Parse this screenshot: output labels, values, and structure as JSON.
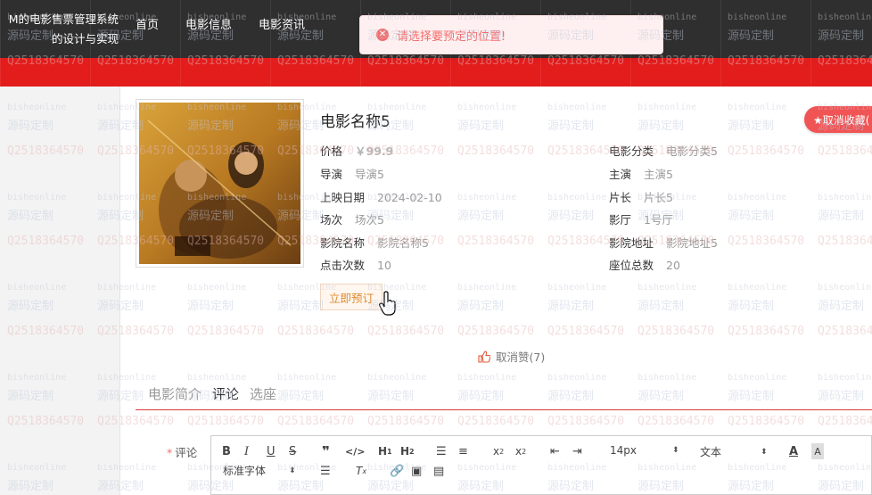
{
  "header": {
    "brand_line1": "M的电影售票管理系统",
    "brand_line2": "的设计与实现",
    "nav": [
      "首页",
      "电影信息",
      "电影资讯"
    ]
  },
  "toast": {
    "icon": "error-circle-icon",
    "message": "请选择要预定的位置!"
  },
  "movie": {
    "title": "电影名称5",
    "left_fields": [
      {
        "label": "价格",
        "value": "￥99.9"
      },
      {
        "label": "导演",
        "value": "导演5"
      },
      {
        "label": "上映日期",
        "value": "2024-02-10"
      },
      {
        "label": "场次",
        "value": "场次5"
      },
      {
        "label": "影院名称",
        "value": "影院名称5"
      },
      {
        "label": "点击次数",
        "value": "10"
      }
    ],
    "right_fields": [
      {
        "label": "电影分类",
        "value": "电影分类5"
      },
      {
        "label": "主演",
        "value": "主演5"
      },
      {
        "label": "片长",
        "value": "片长5"
      },
      {
        "label": "影厅",
        "value": "1号厅"
      },
      {
        "label": "影院地址",
        "value": "影院地址5"
      },
      {
        "label": "座位总数",
        "value": "20"
      }
    ],
    "favorite_label": "★取消收藏(",
    "book_label": "立即预订",
    "like_label": "取消赞(7)"
  },
  "tabs": [
    "电影简介",
    "评论",
    "选座"
  ],
  "active_tab": "评论",
  "comment": {
    "required_mark": "*",
    "label": "评论",
    "font_size": "14px",
    "text_type": "文本",
    "font_family": "标准字体"
  },
  "watermark": {
    "line1": "bisheonline",
    "line2": "源码定制",
    "line3": "Q2518364570"
  },
  "colors": {
    "header_bg": "#2f2f2f",
    "accent_red": "#e31c1c",
    "error": "#f56c6c",
    "book_orange": "#e08a2e"
  }
}
